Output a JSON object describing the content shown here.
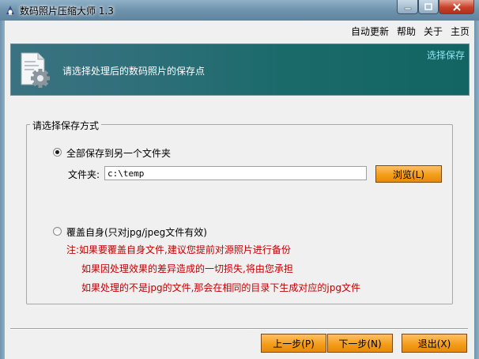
{
  "window": {
    "title": "数码照片压缩大师 1.3",
    "app_icon": "compress-app-icon",
    "controls": {
      "minimize": "minimize-icon",
      "maximize": "maximize-icon",
      "close": "close-icon"
    }
  },
  "menu": {
    "items": [
      {
        "label": "自动更新"
      },
      {
        "label": "帮助"
      },
      {
        "label": "关于"
      },
      {
        "label": "主页"
      }
    ]
  },
  "header": {
    "step_title": "选择保存",
    "description": "请选择处理后的数码照片的保存点",
    "icon": "document-gear-icon"
  },
  "save_options": {
    "legend": "请选择保存方式",
    "option_folder": {
      "label": "全部保存到另一个文件夹",
      "selected": true
    },
    "folder_label": "文件夹:",
    "folder_value": "c:\\temp",
    "browse_label": "浏览(L)",
    "option_overwrite": {
      "label": "覆盖自身(只对jpg/jpeg文件有效)",
      "selected": false
    },
    "notes": [
      "注:如果要覆盖自身文件,建议您提前对源照片进行备份",
      "如果因处理效果的差异造成的一切损失,将由您承担",
      "如果处理的不是jpg的文件,那会在相同的目录下生成对应的jpg文件"
    ]
  },
  "footer": {
    "prev_label": "上一步(P)",
    "next_label": "下一步(N)",
    "exit_label": "退出(X)"
  },
  "colors": {
    "button_orange": "#f39b17",
    "note_red": "#c00000",
    "header_teal": "#1a6a6a",
    "header_link": "#8fe6ef"
  }
}
